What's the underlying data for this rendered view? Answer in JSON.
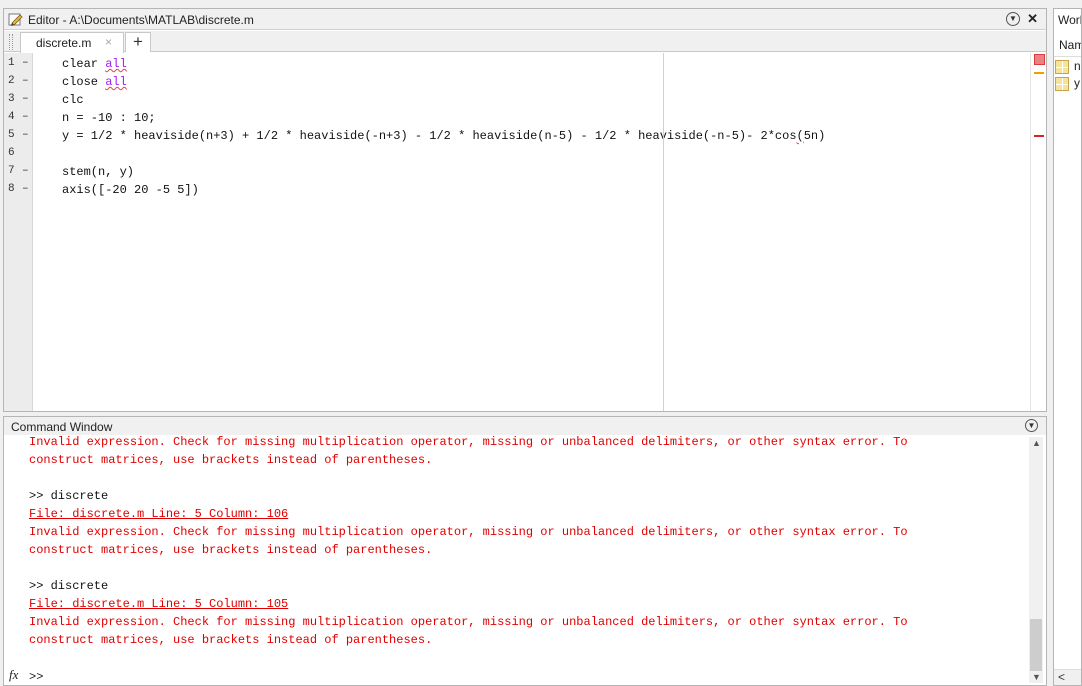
{
  "editor": {
    "title": "Editor - A:\\Documents\\MATLAB\\discrete.m",
    "tab_label": "discrete.m",
    "tab_close": "×",
    "add_tab": "+",
    "close_glyph": "✕",
    "menu_glyph": "▼",
    "lines": [
      {
        "num": "1",
        "dash": "–"
      },
      {
        "num": "2",
        "dash": "–"
      },
      {
        "num": "3",
        "dash": "–"
      },
      {
        "num": "4",
        "dash": "–"
      },
      {
        "num": "5",
        "dash": "–"
      },
      {
        "num": "6",
        "dash": ""
      },
      {
        "num": "7",
        "dash": "–"
      },
      {
        "num": "8",
        "dash": "–"
      }
    ],
    "code": {
      "l1_pre": "clear ",
      "l1_kw": "all",
      "l2_pre": "close ",
      "l2_kw": "all",
      "l3": "clc",
      "l4": "n = -10 : 10;",
      "l5_pre": "y = 1/2 * heaviside(n+3) + 1/2 * heaviside(-n+3) - 1/2 * heaviside(n-5) - 1/2 * heaviside(-n-5)- 2*cos",
      "l5_err": "(",
      "l5_post": "5n)",
      "l7": "stem(n, y)",
      "l8": "axis([-20 20 -5 5])"
    }
  },
  "workspace": {
    "title": "Work",
    "header": "Nam",
    "variables": [
      {
        "name": "n"
      },
      {
        "name": "y"
      }
    ],
    "scroll_left": "<"
  },
  "command_window": {
    "title": "Command Window",
    "menu_glyph": "▼",
    "output": {
      "err1a": "Invalid expression. Check for missing multiplication operator, missing or unbalanced delimiters, or other syntax error. To",
      "err1b": "construct matrices, use brackets instead of parentheses.",
      "cmd1": ">> discrete",
      "link1": "File: discrete.m Line: 5 Column: 106",
      "err2a": "Invalid expression. Check for missing multiplication operator, missing or unbalanced delimiters, or other syntax error. To",
      "err2b": "construct matrices, use brackets instead of parentheses.",
      "cmd2": ">> discrete",
      "link2": "File: discrete.m Line: 5 Column: 105",
      "err3a": "Invalid expression. Check for missing multiplication operator, missing or unbalanced delimiters, or other syntax error. To",
      "err3b": "construct matrices, use brackets instead of parentheses."
    },
    "fx_label": "fx",
    "prompt": ">>"
  },
  "colors": {
    "keyword": "#a020f0",
    "error_text": "#e00000",
    "warning_marker": "#f0a000",
    "error_marker": "#e02020"
  }
}
